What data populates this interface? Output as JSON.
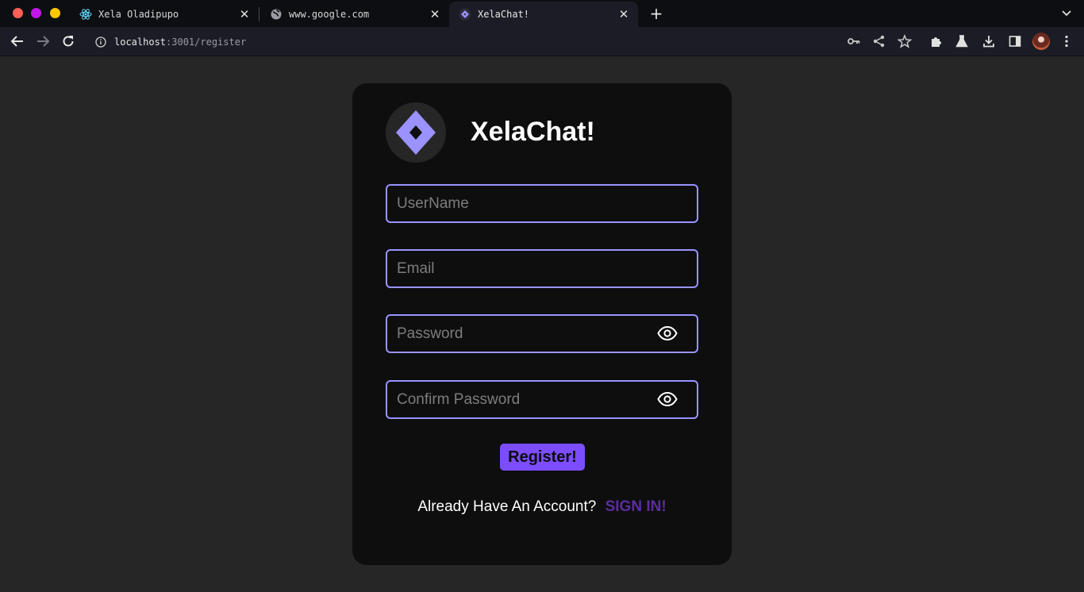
{
  "browser": {
    "tabs": [
      {
        "title": "Xela Oladipupo",
        "favicon": "react-icon",
        "active": false
      },
      {
        "title": "www.google.com",
        "favicon": "globe-icon",
        "active": false
      },
      {
        "title": "XelaChat!",
        "favicon": "xelachat-icon",
        "active": true
      }
    ],
    "address": {
      "host": "localhost",
      "path": ":3001/register"
    },
    "colors": {
      "traffic_close": "#ff5f57",
      "traffic_minimize": "#c216e8",
      "traffic_zoom": "#ffc700"
    }
  },
  "app": {
    "brand": "XelaChat!",
    "logo": "diamond-logo-icon",
    "accent": "#9a93ff",
    "button_color": "#7c4dff",
    "fields": {
      "username": {
        "placeholder": "UserName",
        "value": ""
      },
      "email": {
        "placeholder": "Email",
        "value": ""
      },
      "password": {
        "placeholder": "Password",
        "value": ""
      },
      "confirm_password": {
        "placeholder": "Confirm Password",
        "value": ""
      }
    },
    "register_label": "Register!",
    "signin_prompt": "Already Have An Account?",
    "signin_link": "SIGN IN!"
  }
}
